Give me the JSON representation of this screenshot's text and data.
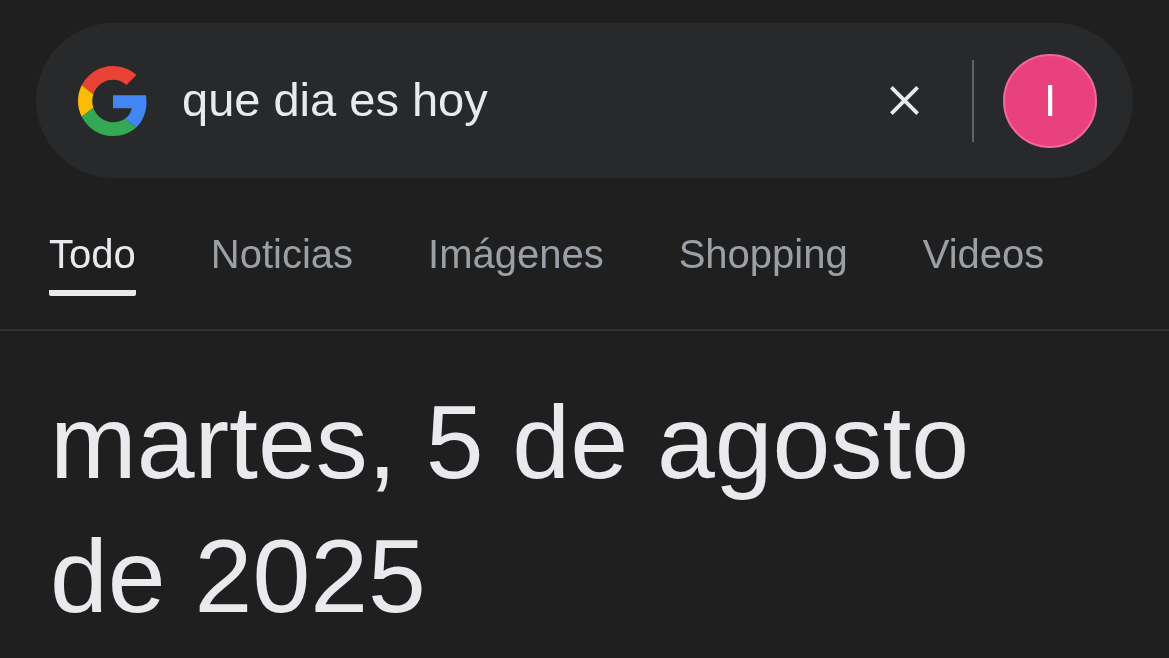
{
  "search": {
    "query": "que dia es hoy",
    "avatar_initial": "I"
  },
  "tabs": [
    {
      "label": "Todo",
      "selected": true
    },
    {
      "label": "Noticias",
      "selected": false
    },
    {
      "label": "Imágenes",
      "selected": false
    },
    {
      "label": "Shopping",
      "selected": false
    },
    {
      "label": "Videos",
      "selected": false
    }
  ],
  "answer": "martes, 5 de agosto de 2025"
}
